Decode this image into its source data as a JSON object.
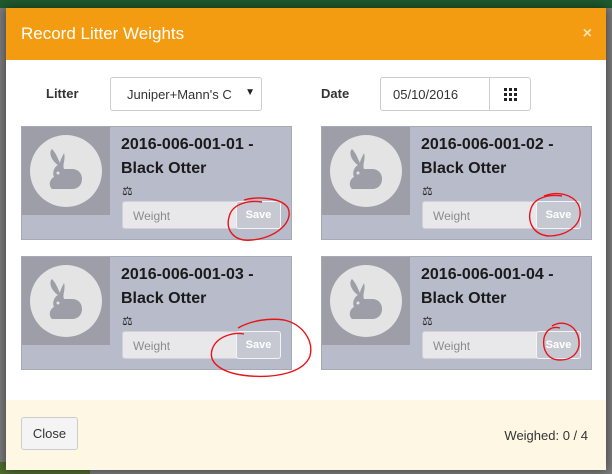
{
  "modal": {
    "title": "Record Litter Weights",
    "close_glyph": "×"
  },
  "form": {
    "litter_label": "Litter",
    "litter_value": "Juniper+Mann's C",
    "date_label": "Date",
    "date_value": "05/10/2016"
  },
  "cards": [
    {
      "line1": "2016-006-001-01 -",
      "line2": "Black Otter",
      "weight_placeholder": "Weight",
      "save_label": "Save"
    },
    {
      "line1": "2016-006-001-02 -",
      "line2": "Black Otter",
      "weight_placeholder": "Weight",
      "save_label": "Save"
    },
    {
      "line1": "2016-006-001-03 -",
      "line2": "Black Otter",
      "weight_placeholder": "Weight",
      "save_label": "Save"
    },
    {
      "line1": "2016-006-001-04 -",
      "line2": "Black Otter",
      "weight_placeholder": "Weight",
      "save_label": "Save"
    }
  ],
  "footer": {
    "close_label": "Close",
    "weighed_text": "Weighed: 0 / 4"
  },
  "colors": {
    "header": "#f39c12",
    "card": "#b8bbc9",
    "footer": "#fdf7e3",
    "annotation": "#e8141b"
  }
}
